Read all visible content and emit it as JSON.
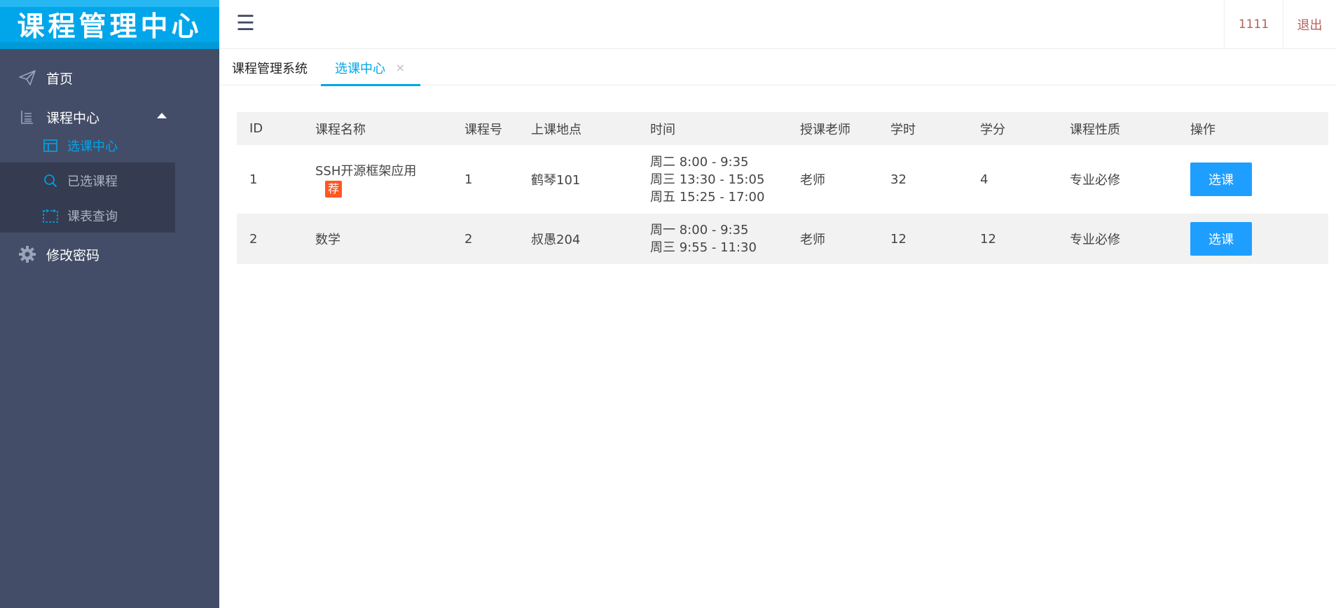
{
  "app": {
    "logo_text": "课程管理中心"
  },
  "sidebar": {
    "items": [
      {
        "label": "首页",
        "icon": "paper-plane-icon"
      },
      {
        "label": "课程中心",
        "icon": "list-icon"
      },
      {
        "label": "修改密码",
        "icon": "gear-icon"
      }
    ],
    "subitems": [
      {
        "label": "选课中心",
        "icon": "table-icon",
        "active": true
      },
      {
        "label": "已选课程",
        "icon": "search-icon"
      },
      {
        "label": "课表查询",
        "icon": "calendar-icon"
      }
    ]
  },
  "header": {
    "user": "1111",
    "logout": "退出",
    "menu_icon": "hamburger-icon"
  },
  "tabs": [
    {
      "label": "课程管理系统"
    },
    {
      "label": "选课中心",
      "close": "×",
      "active": true
    }
  ],
  "table": {
    "headers": [
      "ID",
      "课程名称",
      "课程号",
      "上课地点",
      "时间",
      "授课老师",
      "学时",
      "学分",
      "课程性质",
      "操作"
    ],
    "rows": [
      {
        "id": "1",
        "name": "SSH开源框架应用",
        "badge": "荐",
        "course_no": "1",
        "location": "鹤琴101",
        "times": [
          "周二 8:00 - 9:35",
          "周三 13:30 - 15:05",
          "周五 15:25 - 17:00"
        ],
        "teacher": "老师",
        "hours": "32",
        "credit": "4",
        "type": "专业必修",
        "action": "选课"
      },
      {
        "id": "2",
        "name": "数学",
        "course_no": "2",
        "location": "叔愚204",
        "times": [
          "周一 8:00 - 9:35",
          "周三 9:55 - 11:30"
        ],
        "teacher": "老师",
        "hours": "12",
        "credit": "12",
        "type": "专业必修",
        "action": "选课"
      }
    ]
  },
  "colors": {
    "accent": "#00a6e9",
    "sidebar_bg": "#434d68",
    "submenu_bg": "#353c51",
    "button": "#1e9fff",
    "badge": "#ff5722",
    "header_text": "#b4605a"
  }
}
